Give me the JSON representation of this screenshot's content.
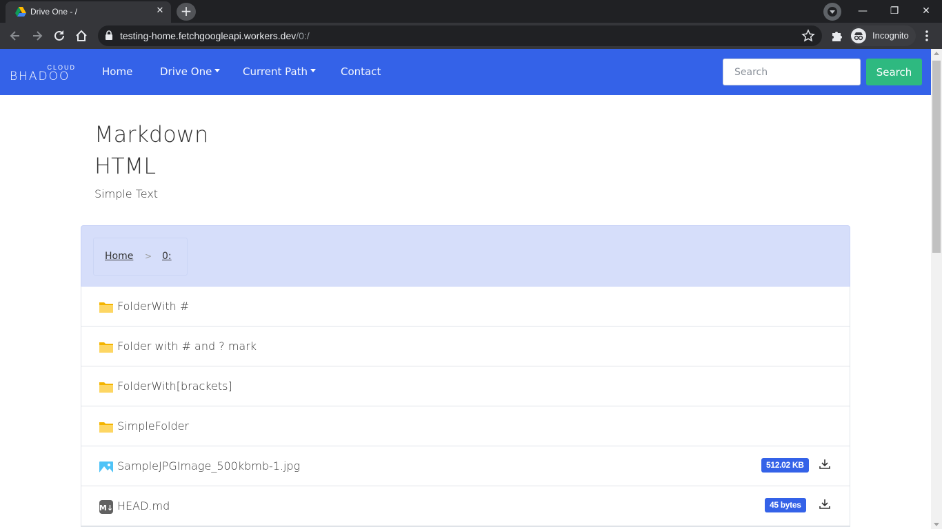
{
  "browser": {
    "tab_title": "Drive One - /",
    "new_tab": "+",
    "url_host": "testing-home.fetchgoogleapi.workers.dev",
    "url_path": "/0:/",
    "profile_label": "Incognito",
    "window_controls": {
      "minimize": "—",
      "restore": "❐",
      "close": "✕"
    }
  },
  "navbar": {
    "brand_top": "CLOUD",
    "brand_main": "BHADOO",
    "items": [
      {
        "label": "Home",
        "dropdown": false
      },
      {
        "label": "Drive One",
        "dropdown": true
      },
      {
        "label": "Current Path",
        "dropdown": true
      },
      {
        "label": "Contact",
        "dropdown": false
      }
    ],
    "search_placeholder": "Search",
    "search_button": "Search",
    "colors": {
      "navbar": "#3462e8",
      "search_button": "#2eb980"
    }
  },
  "readme": {
    "heading1": "Markdown",
    "heading2": "HTML",
    "paragraph": "Simple Text"
  },
  "breadcrumb": {
    "home": "Home",
    "separator": ">",
    "current": "0:"
  },
  "files": [
    {
      "name": "FolderWith #",
      "type": "folder",
      "size": ""
    },
    {
      "name": "Folder with # and ? mark",
      "type": "folder",
      "size": ""
    },
    {
      "name": "FolderWith[brackets]",
      "type": "folder",
      "size": ""
    },
    {
      "name": "SimpleFolder",
      "type": "folder",
      "size": ""
    },
    {
      "name": "SampleJPGImage_500kbmb-1.jpg",
      "type": "image",
      "size": "512.02 KB"
    },
    {
      "name": "HEAD.md",
      "type": "markdown",
      "size": "45 bytes"
    }
  ]
}
